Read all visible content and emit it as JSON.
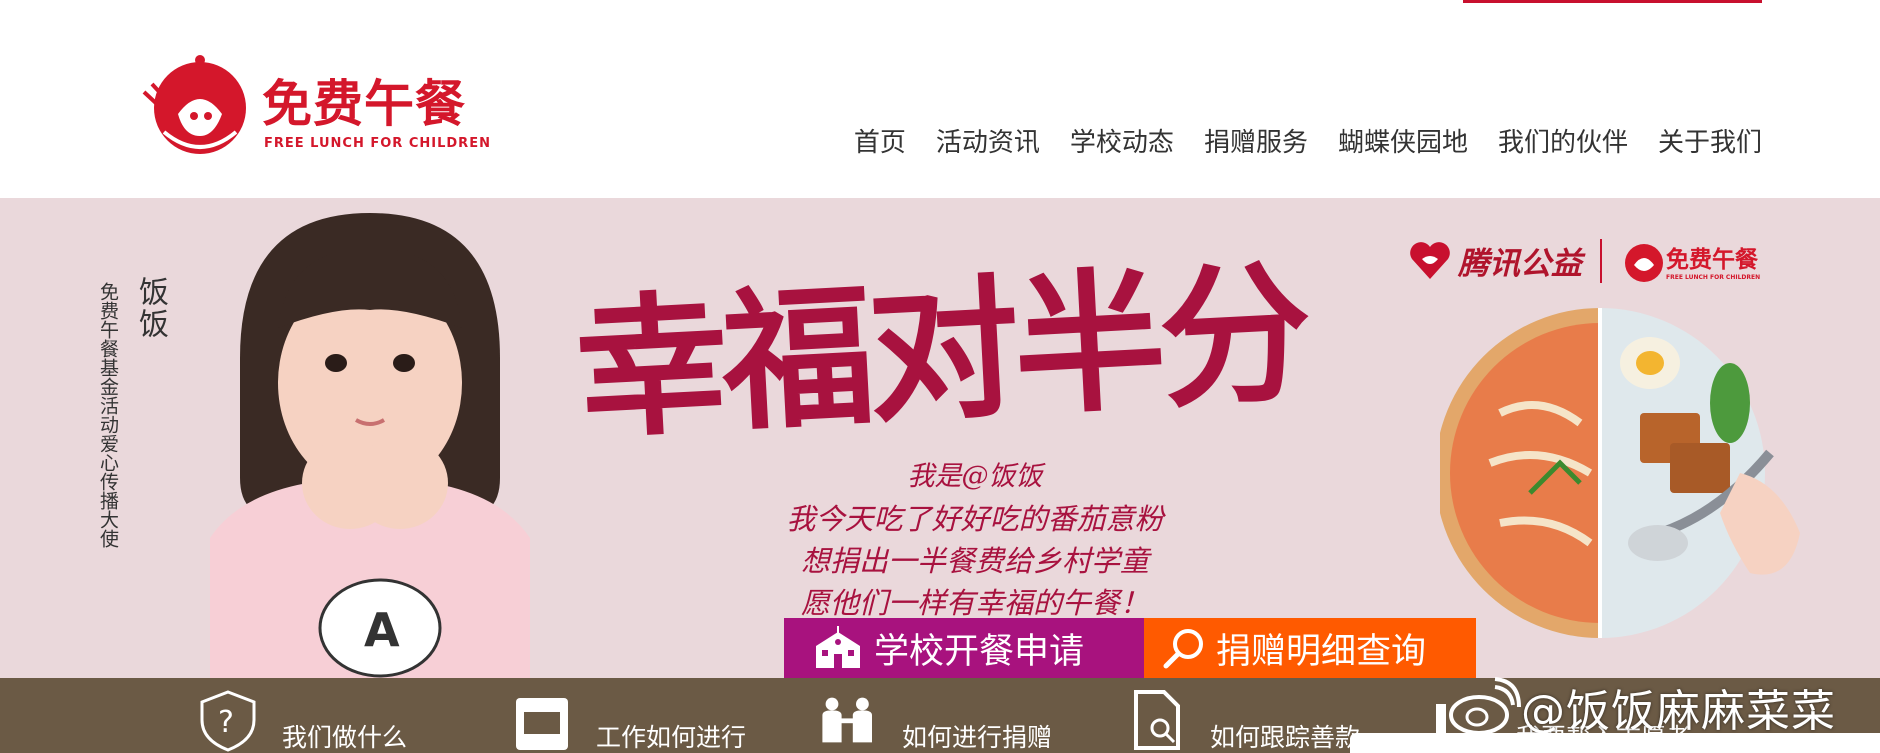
{
  "logo": {
    "cn": "免费午餐",
    "en": "FREE LUNCH FOR CHILDREN"
  },
  "nav": [
    "首页",
    "活动资讯",
    "学校动态",
    "捐赠服务",
    "蝴蝶侠园地",
    "我们的伙伴",
    "关于我们"
  ],
  "banner": {
    "side_vertical": "免费午餐基金活动爱心传播大使",
    "side_name": "饭饭",
    "title": "幸福对半分",
    "lines": [
      "我是@饭饭",
      "我今天吃了好好吃的番茄意粉",
      "想捐出一半餐费给乡村学童",
      "愿他们一样有幸福的午餐！"
    ],
    "partner_tencent": "腾讯公益",
    "partner_ff_cn": "免费午餐",
    "partner_ff_en": "FREE LUNCH FOR CHILDREN"
  },
  "cta": {
    "apply": "学校开餐申请",
    "query": "捐赠明细查询"
  },
  "features": [
    "我们做什么",
    "工作如何进行",
    "如何进行捐赠",
    "如何跟踪善款",
    "我要帮入志愿者"
  ],
  "watermark": "@饭饭麻麻菜菜",
  "colors": {
    "brand": "#d4172b",
    "title": "#a8123f",
    "apply": "#a8127e",
    "query": "#ff5a00",
    "bar": "#6b5a45"
  }
}
